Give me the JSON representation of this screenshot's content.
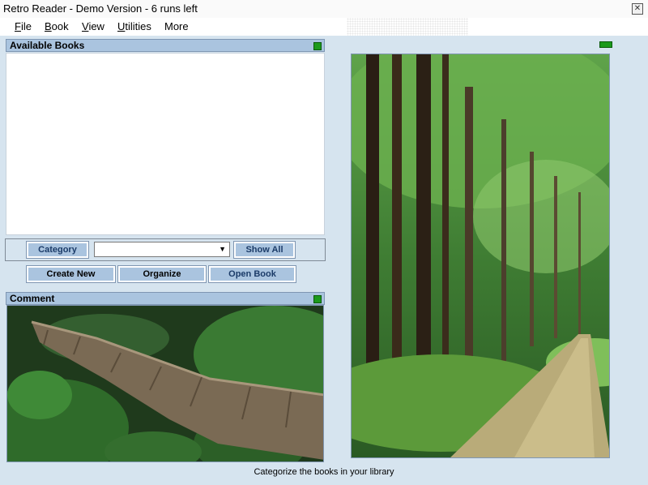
{
  "window": {
    "title": "Retro Reader - Demo Version - 6 runs left"
  },
  "menu": [
    {
      "label": "File",
      "underline": "F",
      "rest": "ile"
    },
    {
      "label": "Book",
      "underline": "B",
      "rest": "ook"
    },
    {
      "label": "View",
      "underline": "V",
      "rest": "iew"
    },
    {
      "label": "Utilities",
      "underline": "U",
      "rest": "tilities"
    },
    {
      "label": "More",
      "underline": "",
      "rest": "More"
    }
  ],
  "books_panel": {
    "title": "Available Books"
  },
  "controls": {
    "category": "Category",
    "category_selected": "",
    "show_all": "Show All",
    "create_new": "Create New",
    "organize": "Organize",
    "open_book": "Open Book"
  },
  "comment_panel": {
    "title": "Comment"
  },
  "status": {
    "text": "Categorize the books in your library"
  }
}
